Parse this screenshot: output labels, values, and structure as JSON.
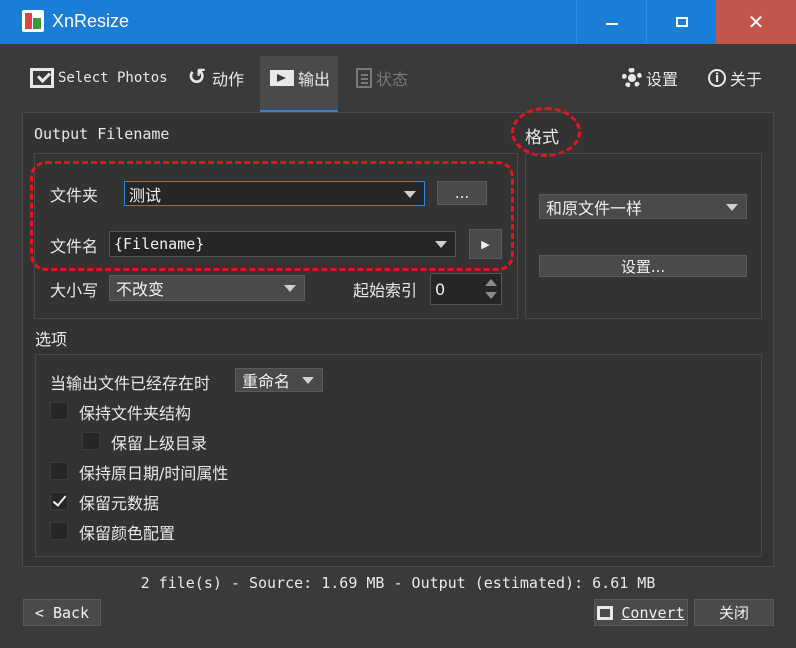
{
  "window": {
    "title": "XnResize",
    "close_glyph": "✕"
  },
  "toolbar": {
    "select_photos": "Select Photos",
    "actions": "动作",
    "output": "输出",
    "status": "状态",
    "settings": "设置",
    "about": "关于",
    "about_glyph": "i",
    "undo_glyph": "↺"
  },
  "output_filename": {
    "group_label": "Output Filename",
    "folder_label": "文件夹",
    "folder_value": "测试",
    "browse_label": "...",
    "filename_label": "文件名",
    "filename_value": "{Filename}",
    "filename_menu_glyph": "▶",
    "case_label": "大小写",
    "case_value": "不改变",
    "start_index_label": "起始索引",
    "start_index_value": "0"
  },
  "format": {
    "group_label": "格式",
    "format_value": "和原文件一样",
    "settings_label": "设置..."
  },
  "options": {
    "group_label": "选项",
    "if_exists_label": "当输出文件已经存在时",
    "if_exists_value": "重命名",
    "items": [
      {
        "label": "保持文件夹结构",
        "checked": false
      },
      {
        "label": "保留上级目录",
        "checked": false
      },
      {
        "label": "保持原日期/时间属性",
        "checked": false
      },
      {
        "label": "保留元数据",
        "checked": true
      },
      {
        "label": "保留颜色配置",
        "checked": false
      }
    ]
  },
  "footer": {
    "status_text": "2 file(s) - Source: 1.69 MB - Output (estimated): 6.61 MB",
    "back_label": "< Back",
    "convert_label": "Convert",
    "close_label": "关闭"
  },
  "colors": {
    "titlebar": "#1a7ed6",
    "close_button": "#c4554b",
    "highlight": "#e8141e",
    "accent": "#2e86d8"
  }
}
